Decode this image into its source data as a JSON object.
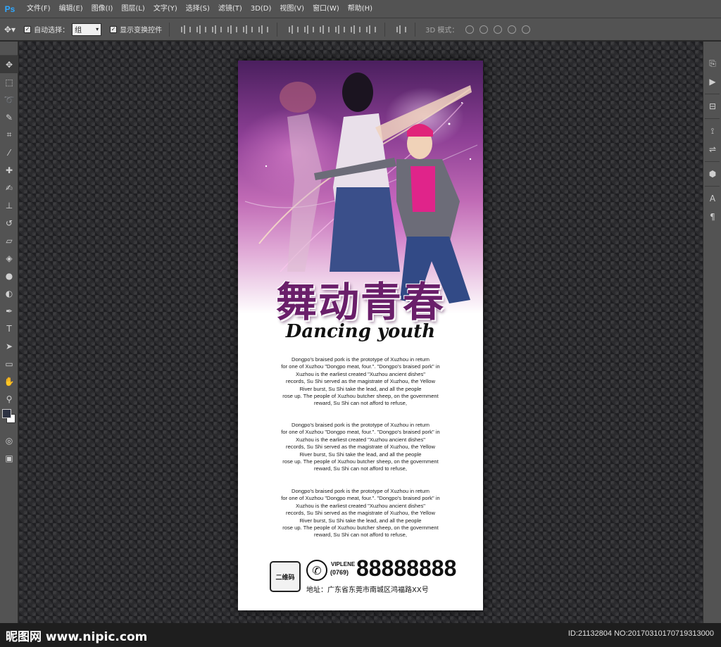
{
  "app": {
    "logo": "Ps"
  },
  "menu": [
    "文件(F)",
    "编辑(E)",
    "图像(I)",
    "图层(L)",
    "文字(Y)",
    "选择(S)",
    "滤镜(T)",
    "3D(D)",
    "视图(V)",
    "窗口(W)",
    "帮助(H)"
  ],
  "options": {
    "auto_select_label": "自动选择：",
    "auto_select_value": "组",
    "show_transform_label": "显示变换控件",
    "mode_3d_label": "3D 模式："
  },
  "poster": {
    "title": "舞动青春",
    "subtitle": "Dancing youth",
    "paragraphs": [
      "Dongpo's braised pork is the prototype of Xuzhou in return\nfor one of Xuzhou \"Dongpo meat, four.\". \"Dongpo's braised pork\" in\nXuzhou is the earliest created \"Xuzhou ancient dishes\"\nrecords, Su Shi served as the magistrate of Xuzhou, the Yellow\nRiver burst, Su Shi take the lead, and all the people\nrose up. The people of Xuzhou butcher sheep, on the government\nreward, Su Shi can not afford to refuse,",
      "Dongpo's braised pork is the prototype of Xuzhou in return\nfor one of Xuzhou \"Dongpo meat, four.\". \"Dongpo's braised pork\" in\nXuzhou is the earliest created \"Xuzhou ancient dishes\"\nrecords, Su Shi served as the magistrate of Xuzhou, the Yellow\nRiver burst, Su Shi take the lead, and all the people\nrose up. The people of Xuzhou butcher sheep, on the government\nreward, Su Shi can not afford to refuse,",
      "Dongpo's braised pork is the prototype of Xuzhou in return\nfor one of Xuzhou \"Dongpo meat, four.\". \"Dongpo's braised pork\" in\nXuzhou is the earliest created \"Xuzhou ancient dishes\"\nrecords, Su Shi served as the magistrate of Xuzhou, the Yellow\nRiver burst, Su Shi take the lead, and all the people\nrose up. The people of Xuzhou butcher sheep, on the government\nreward, Su Shi can not afford to refuse,"
    ],
    "qr_label": "二维码",
    "brand": "VIPLENE",
    "area_code": "(0769)",
    "phone": "88888888",
    "address": "地址：广东省东莞市南城区鸿福路XX号"
  },
  "watermark": {
    "site": "昵图网 www.nipic.com",
    "id": "ID:21132804 NO:20170310170719313000"
  },
  "colors": {
    "title": "#6a1f6a",
    "panel": "#535353",
    "canvas": "#2a2a2d"
  }
}
